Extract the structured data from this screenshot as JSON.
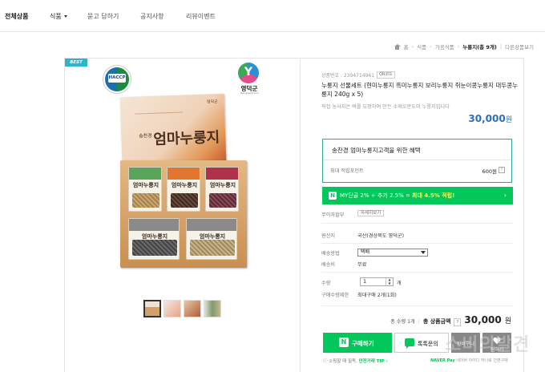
{
  "nav": {
    "items": [
      "전체상품",
      "식품",
      "묻고 답하기",
      "공지사항",
      "리뷰이벤트"
    ]
  },
  "breadcrumb": {
    "items": [
      "홈",
      "식품",
      "가공식품",
      "누룽지(총 9개)",
      "다른상품보기"
    ]
  },
  "badge": {
    "best": "BEST"
  },
  "haccp": {
    "label": "HACCP"
  },
  "brand_logo": {
    "name": "영덕군",
    "sub": "Yeongdeok-Gun"
  },
  "box": {
    "brand": "엄마누룽지",
    "maker": "송찬경"
  },
  "product": {
    "id_label": "상품번호 : 2394714961",
    "qr_label": "QR코드",
    "title": "누룽지 선물세트 (현미누룽지 흑미누룽지 보리누룽지 쥐눈이콩누룽지 대두콩누룽지 240g x 5)",
    "desc": "직접 농사지은 벼를 도정하여 만든 수제오분도미 누룽지입니다",
    "price": "30,000",
    "won": "원"
  },
  "benefit": {
    "heading": "송찬경 엄마누룽지고객을 위한 혜택",
    "point_label": "최대 적립포인트",
    "point_value": "600원",
    "help": "?"
  },
  "mybar": {
    "icon": "N",
    "text_a": "MY단골 2% + 추가 2.5% = ",
    "text_b": "최대 4.5% 적립!",
    "arrow": "›"
  },
  "rows": {
    "installment_label": "무이자할부",
    "installment_btn": "자세히보기",
    "origin_label": "원산지",
    "origin_value": "국산(경상북도 영덕군)",
    "ship_method_label": "배송방법",
    "ship_method_value": "택배",
    "ship_fee_label": "배송비",
    "ship_fee_value": "무료",
    "qty_label": "수량",
    "qty_value": "1",
    "qty_unit": "개",
    "limit_label": "구매수량제한",
    "limit_value": "최대구매 2개(1회)"
  },
  "total": {
    "count": "총 수량 1개",
    "label": "총 상품금액",
    "help": "?",
    "amount": "30,000",
    "won": "원"
  },
  "buttons": {
    "buy": "구매하기",
    "buy_icon": "N",
    "talk": "톡톡문의",
    "cart": "장바구니",
    "wish": "찜하기"
  },
  "footer": {
    "notice_a": "소핑할 때 필독, ",
    "notice_b": "안전거래 TIP",
    "notice_c": " ›",
    "npay_a": "NAVER Pay",
    "npay_b": " 네이버 아이디 하나로 간편구매"
  },
  "watermark": "소비의발견"
}
